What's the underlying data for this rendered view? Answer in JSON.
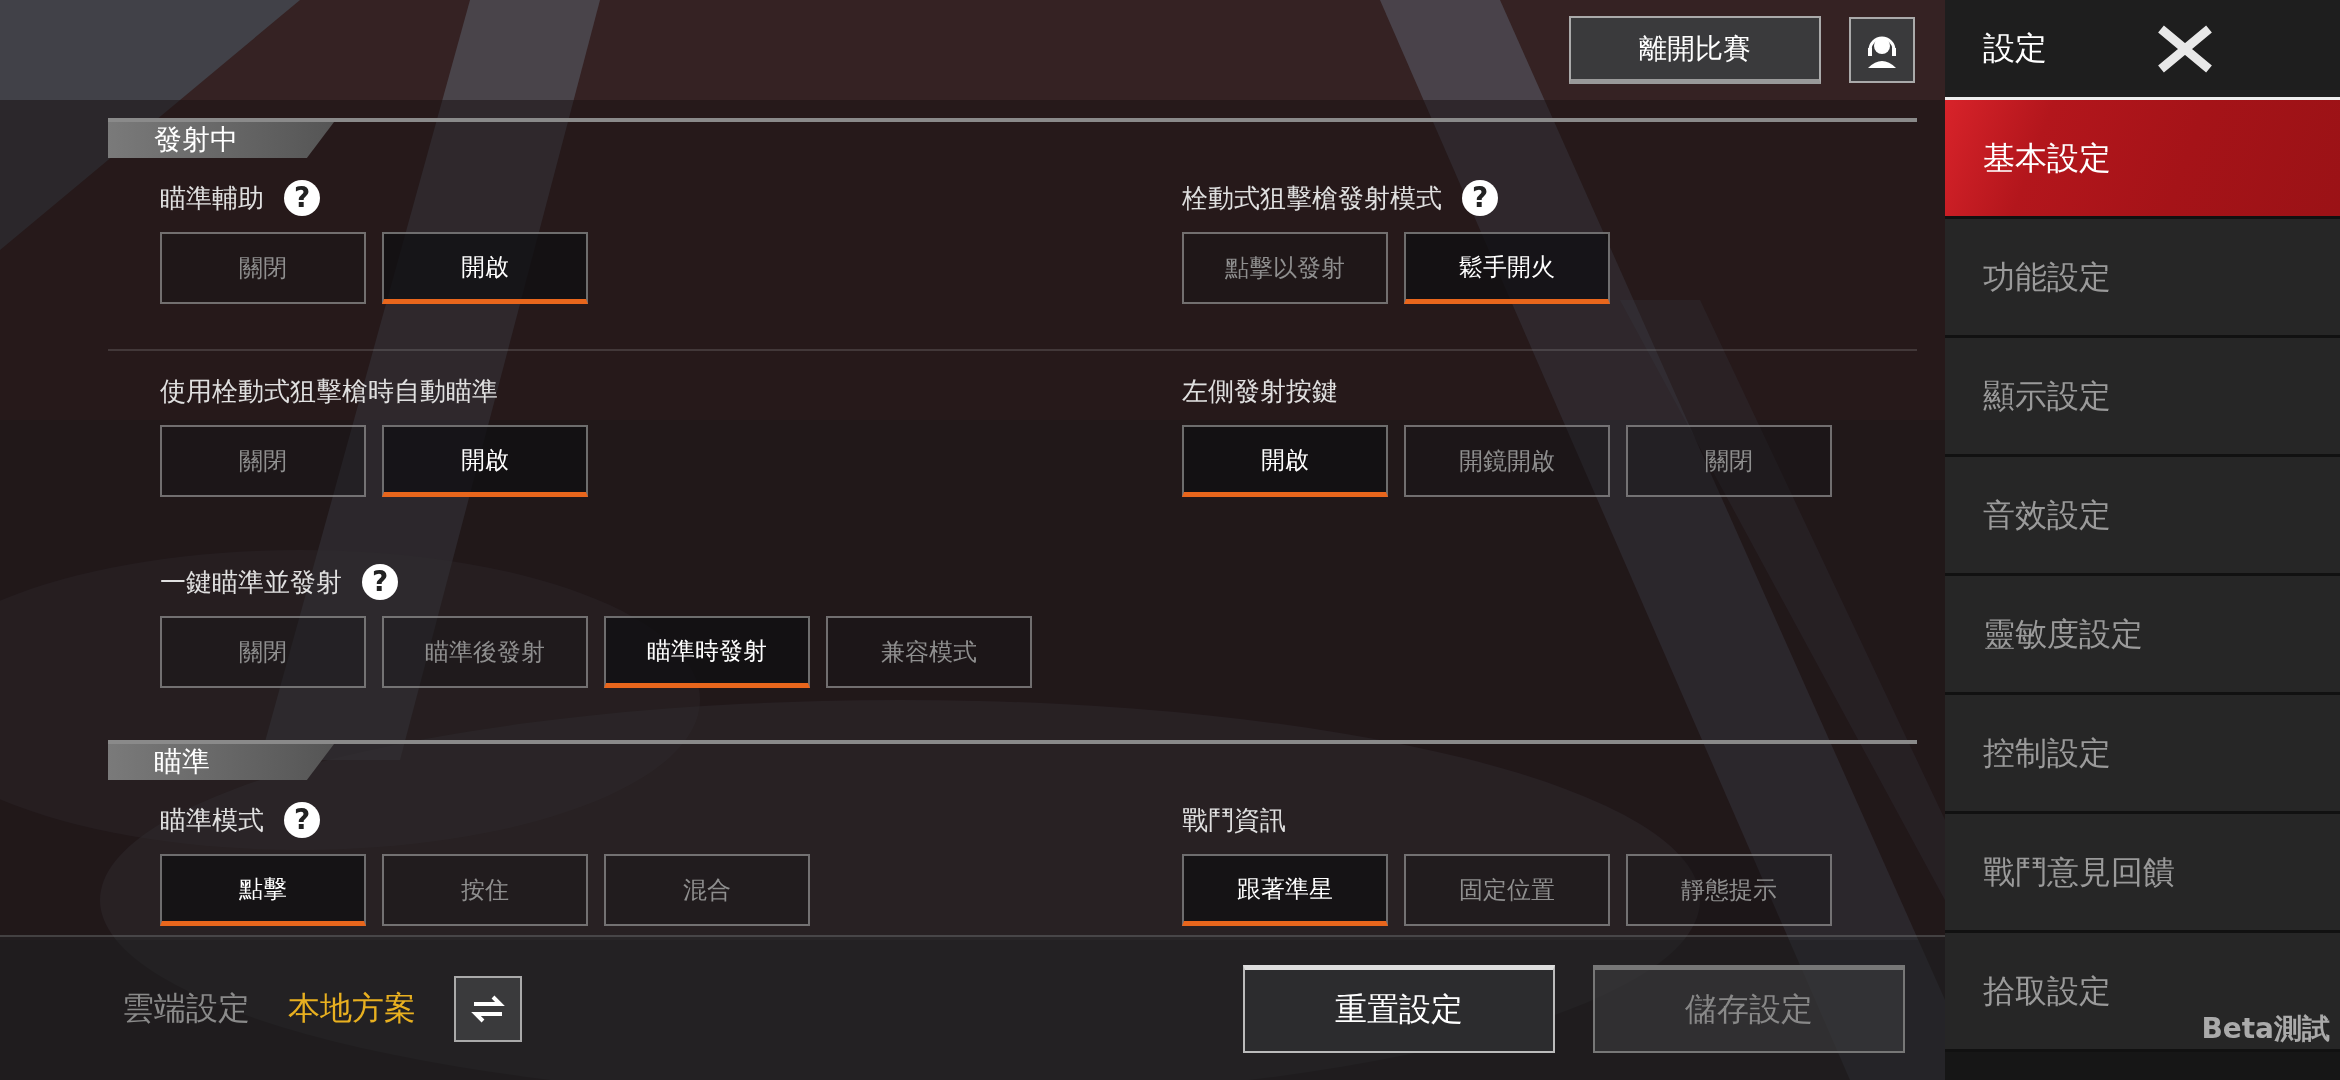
{
  "top_bar": {
    "leave_button": "離開比賽"
  },
  "sections": [
    {
      "title": "發射中",
      "rows": [
        [
          {
            "label": "瞄準輔助",
            "help": "?",
            "options": [
              {
                "label": "關閉",
                "selected": false
              },
              {
                "label": "開啟",
                "selected": true
              }
            ]
          },
          {
            "label": "栓動式狙擊槍發射模式",
            "help": "?",
            "options": [
              {
                "label": "點擊以發射",
                "selected": false
              },
              {
                "label": "鬆手開火",
                "selected": true
              }
            ]
          }
        ],
        [
          {
            "label": "使用栓動式狙擊槍時自動瞄準",
            "options": [
              {
                "label": "關閉",
                "selected": false
              },
              {
                "label": "開啟",
                "selected": true
              }
            ]
          },
          {
            "label": "左側發射按鍵",
            "options": [
              {
                "label": "開啟",
                "selected": true
              },
              {
                "label": "開鏡開啟",
                "selected": false
              },
              {
                "label": "關閉",
                "selected": false
              }
            ]
          }
        ],
        [
          {
            "label": "一鍵瞄準並發射",
            "help": "?",
            "options": [
              {
                "label": "關閉",
                "selected": false
              },
              {
                "label": "瞄準後發射",
                "selected": false
              },
              {
                "label": "瞄準時發射",
                "selected": true
              },
              {
                "label": "兼容模式",
                "selected": false
              }
            ]
          }
        ]
      ]
    },
    {
      "title": "瞄準",
      "rows": [
        [
          {
            "label": "瞄準模式",
            "help": "?",
            "options": [
              {
                "label": "點擊",
                "selected": true
              },
              {
                "label": "按住",
                "selected": false
              },
              {
                "label": "混合",
                "selected": false
              }
            ]
          },
          {
            "label": "戰鬥資訊",
            "options": [
              {
                "label": "跟著準星",
                "selected": true
              },
              {
                "label": "固定位置",
                "selected": false
              },
              {
                "label": "靜態提示",
                "selected": false
              }
            ]
          }
        ]
      ]
    }
  ],
  "bottom_bar": {
    "presets": [
      {
        "label": "雲端設定",
        "selected": false
      },
      {
        "label": "本地方案",
        "selected": true
      }
    ],
    "buttons": [
      {
        "label": "重置設定",
        "disabled": false
      },
      {
        "label": "儲存設定",
        "disabled": true
      }
    ]
  },
  "sidebar": {
    "title": "設定",
    "items": [
      {
        "label": "基本設定",
        "selected": true
      },
      {
        "label": "功能設定",
        "selected": false
      },
      {
        "label": "顯示設定",
        "selected": false
      },
      {
        "label": "音效設定",
        "selected": false
      },
      {
        "label": "靈敏度設定",
        "selected": false
      },
      {
        "label": "控制設定",
        "selected": false
      },
      {
        "label": "戰鬥意見回饋",
        "selected": false
      },
      {
        "label": "拾取設定",
        "selected": false
      }
    ],
    "badge": "Beta測試"
  }
}
